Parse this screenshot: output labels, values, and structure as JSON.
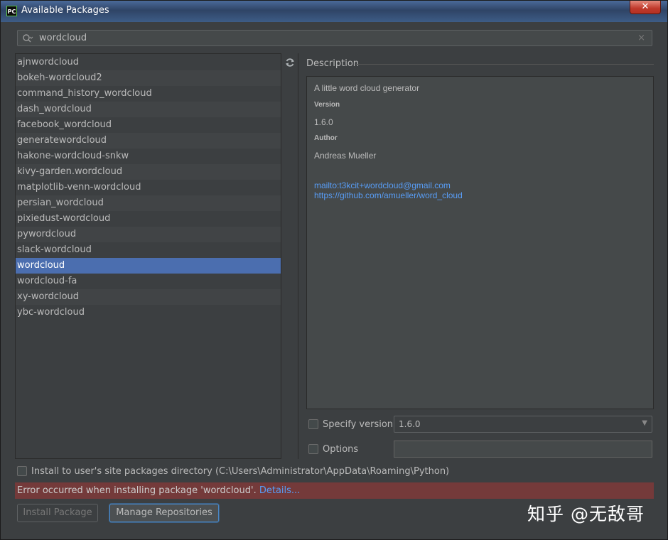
{
  "window": {
    "title": "Available Packages",
    "app_icon": "PC",
    "close_glyph": "✕"
  },
  "search": {
    "value": "wordcloud",
    "clear_glyph": "×"
  },
  "packages": [
    "ajnwordcloud",
    "bokeh-wordcloud2",
    "command_history_wordcloud",
    "dash_wordcloud",
    "facebook_wordcloud",
    "generatewordcloud",
    "hakone-wordcloud-snkw",
    "kivy-garden.wordcloud",
    "matplotlib-venn-wordcloud",
    "persian_wordcloud",
    "pixiedust-wordcloud",
    "pywordcloud",
    "slack-wordcloud",
    "wordcloud",
    "wordcloud-fa",
    "xy-wordcloud",
    "ybc-wordcloud"
  ],
  "selected_package": "wordcloud",
  "description": {
    "header": "Description",
    "summary": "A little word cloud generator",
    "version_label": "Version",
    "version_value": "1.6.0",
    "author_label": "Author",
    "author_value": "Andreas Mueller",
    "email_link": "mailto:t3kcit+wordcloud@gmail.com",
    "repo_link": "https://github.com/amueller/word_cloud"
  },
  "specify_version": {
    "label": "Specify version",
    "value": "1.6.0",
    "checked": false
  },
  "options": {
    "label": "Options",
    "value": "",
    "checked": false
  },
  "install_user": {
    "label": "Install to user's site packages directory (C:\\Users\\Administrator\\AppData\\Roaming\\Python)",
    "checked": false
  },
  "error": {
    "message": "Error occurred when installing package 'wordcloud'. ",
    "details_link": "Details..."
  },
  "buttons": {
    "install": "Install Package",
    "manage": "Manage Repositories"
  },
  "watermark": "知乎 @无敌哥",
  "colors": {
    "selection": "#4b6eaf",
    "error_bg": "#743a3a",
    "link": "#589df6"
  }
}
